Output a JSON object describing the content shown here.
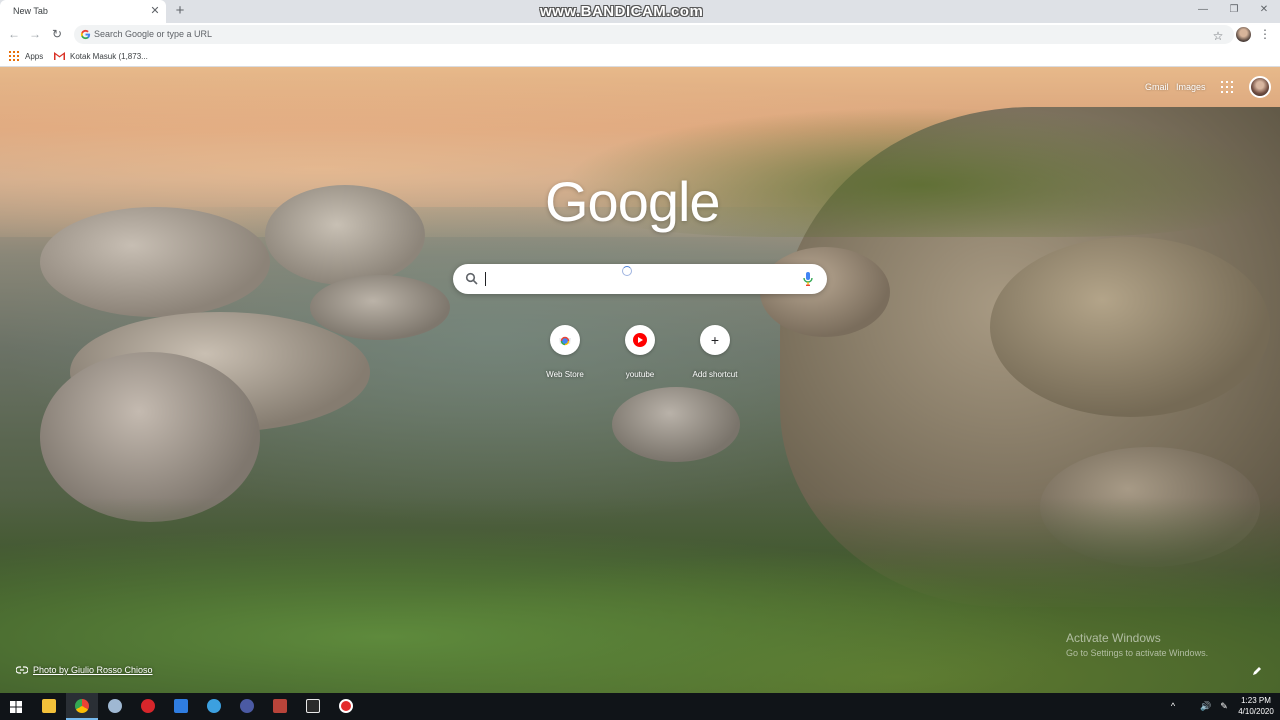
{
  "browser": {
    "tab": {
      "title": "New Tab",
      "close_glyph": "✕"
    },
    "new_tab_glyph": "+",
    "watermark": "www.BANDICAM.com",
    "window_controls": {
      "minimize": "—",
      "restore": "❐",
      "close": "✕"
    },
    "nav": {
      "back": "←",
      "forward": "→",
      "reload": "↻"
    },
    "omnibox": {
      "placeholder": "Search Google or type a URL"
    },
    "bookmark_star": "☆",
    "menu_glyph": "⋮",
    "bookmarks": [
      {
        "label": "Apps",
        "icon": "apps-grid-icon"
      },
      {
        "label": "Kotak Masuk (1,873...",
        "icon": "gmail-icon"
      }
    ]
  },
  "new_tab_page": {
    "top_links": {
      "gmail": "Gmail",
      "images": "Images"
    },
    "logo": "Google",
    "search": {
      "value": ""
    },
    "shortcuts": [
      {
        "label": "Web Store",
        "icon": "chrome-web-store-icon"
      },
      {
        "label": "youtube",
        "icon": "youtube-icon"
      },
      {
        "label": "Add shortcut",
        "icon": "plus-icon",
        "glyph": "+"
      }
    ],
    "photo_credit": "Photo by Giulio Rosso Chioso",
    "activate_windows": {
      "title": "Activate Windows",
      "subtitle": "Go to Settings to activate Windows."
    }
  },
  "taskbar": {
    "pinned": [
      {
        "name": "start-icon",
        "color": "#ffffff"
      },
      {
        "name": "file-explorer-icon",
        "color": "#f3c13a"
      },
      {
        "name": "chrome-icon",
        "color": "#e34133",
        "active": true
      },
      {
        "name": "steam-icon",
        "color": "#9fb8d3"
      },
      {
        "name": "game-launcher-icon",
        "color": "#d6262b"
      },
      {
        "name": "app-icon",
        "color": "#2f7de1"
      },
      {
        "name": "browser-icon",
        "color": "#3ca0e0"
      },
      {
        "name": "uplay-icon",
        "color": "#4b5aa3"
      },
      {
        "name": "game-icon",
        "color": "#b8443a"
      },
      {
        "name": "pubg-icon",
        "color": "#e8e8e8"
      },
      {
        "name": "bandicam-record-icon",
        "color": "#e42b2b"
      }
    ],
    "tray": {
      "time": "1:23 PM",
      "date": "4/10/2020",
      "icons": [
        "^",
        "🔊",
        "✎"
      ]
    }
  }
}
